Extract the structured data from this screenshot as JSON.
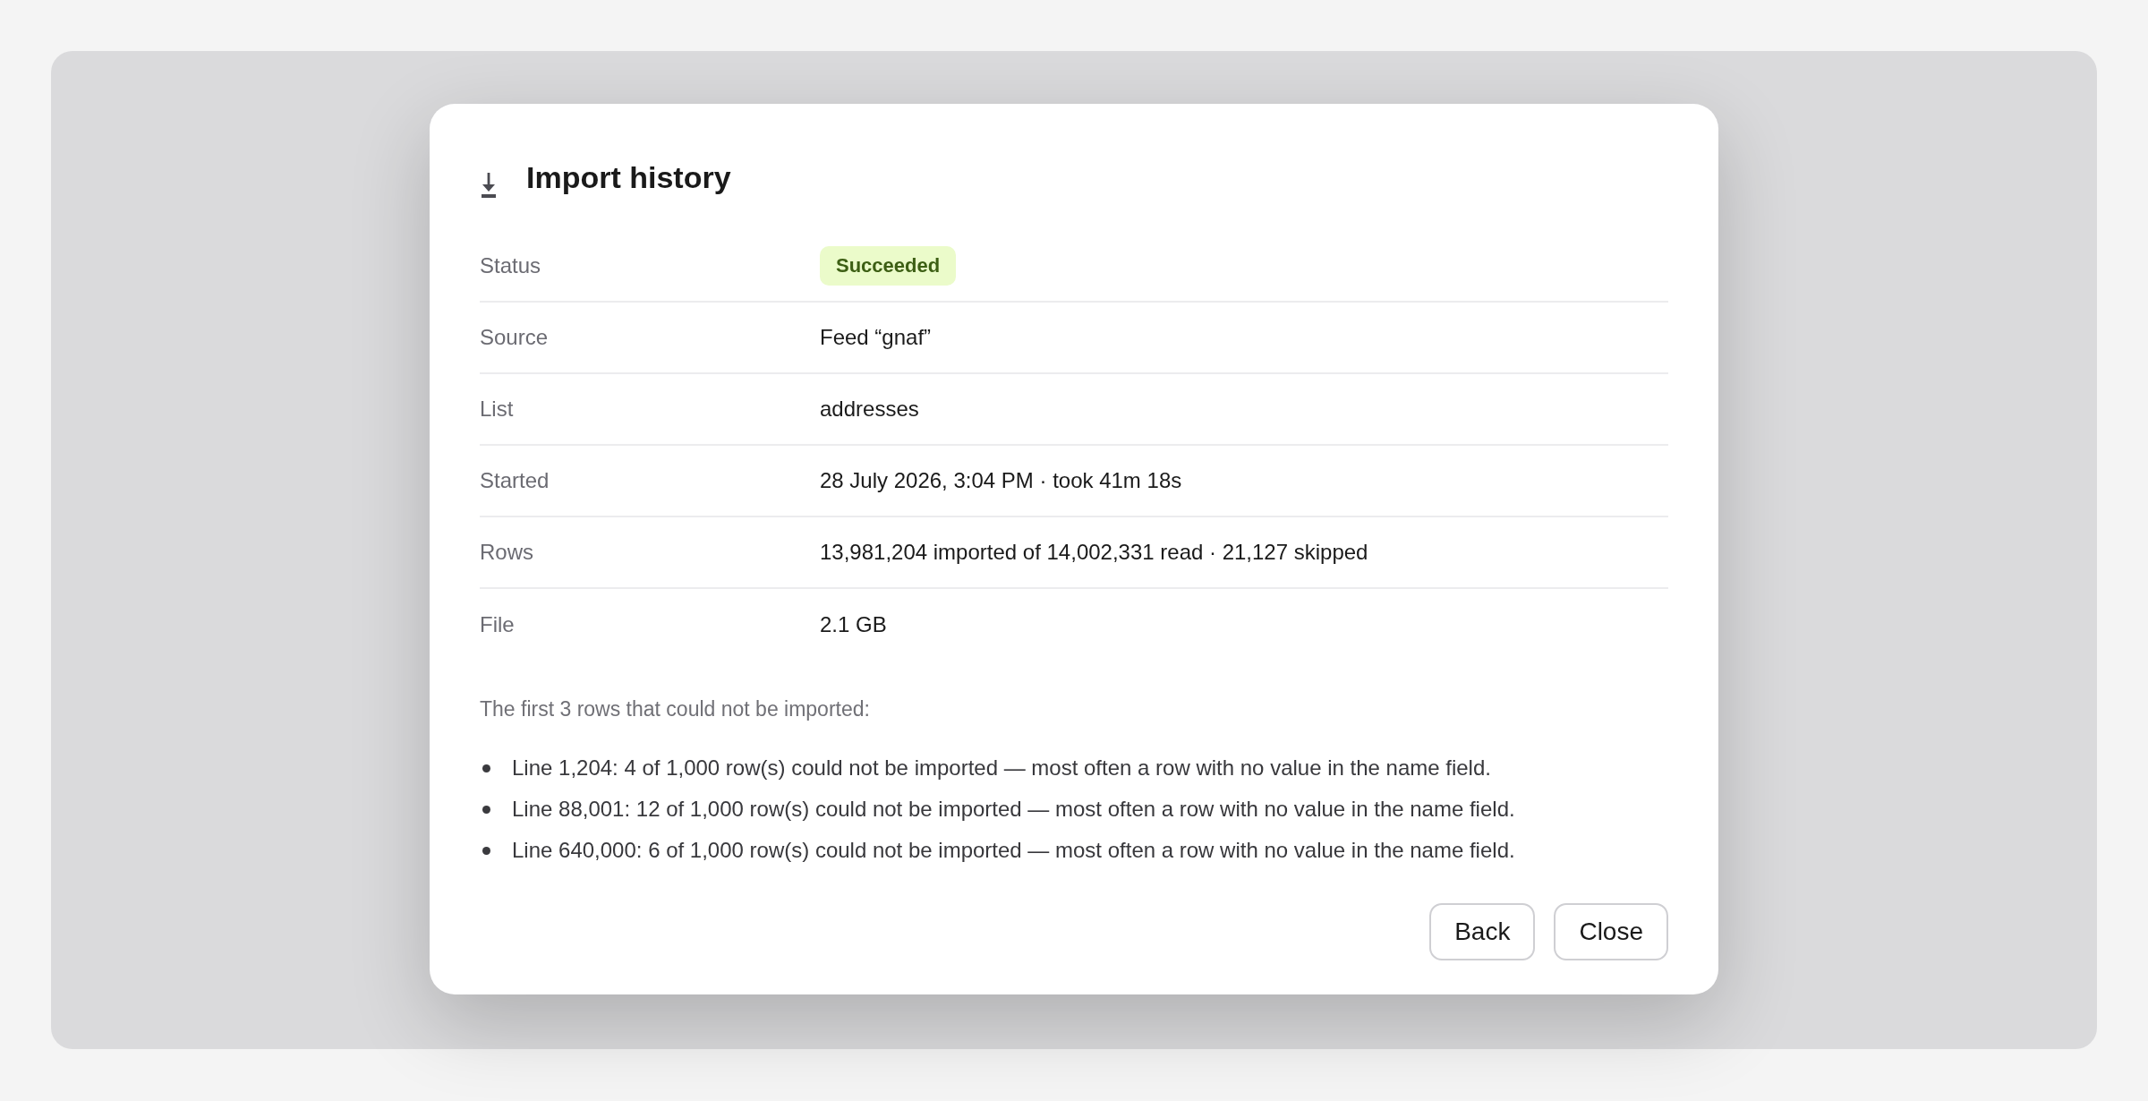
{
  "dialog": {
    "title": "Import history",
    "details": [
      {
        "label": "Status",
        "kind": "badge",
        "value": "Succeeded"
      },
      {
        "label": "Source",
        "kind": "text",
        "value": "Feed “gnaf”"
      },
      {
        "label": "List",
        "kind": "text",
        "value": "addresses"
      },
      {
        "label": "Started",
        "kind": "text",
        "value": "28 July 2026, 3:04 PM · took 41m 18s"
      },
      {
        "label": "Rows",
        "kind": "text",
        "value": "13,981,204 imported of 14,002,331 read · 21,127 skipped"
      },
      {
        "label": "File",
        "kind": "text",
        "value": "2.1 GB"
      }
    ],
    "errors": {
      "caption": "The first 3 rows that could not be imported:",
      "items": [
        "Line 1,204: 4 of 1,000 row(s) could not be imported — most often a row with no value in the name field.",
        "Line 88,001: 12 of 1,000 row(s) could not be imported — most often a row with no value in the name field.",
        "Line 640,000: 6 of 1,000 row(s) could not be imported — most often a row with no value in the name field."
      ]
    },
    "buttons": [
      "Back",
      "Close"
    ]
  }
}
